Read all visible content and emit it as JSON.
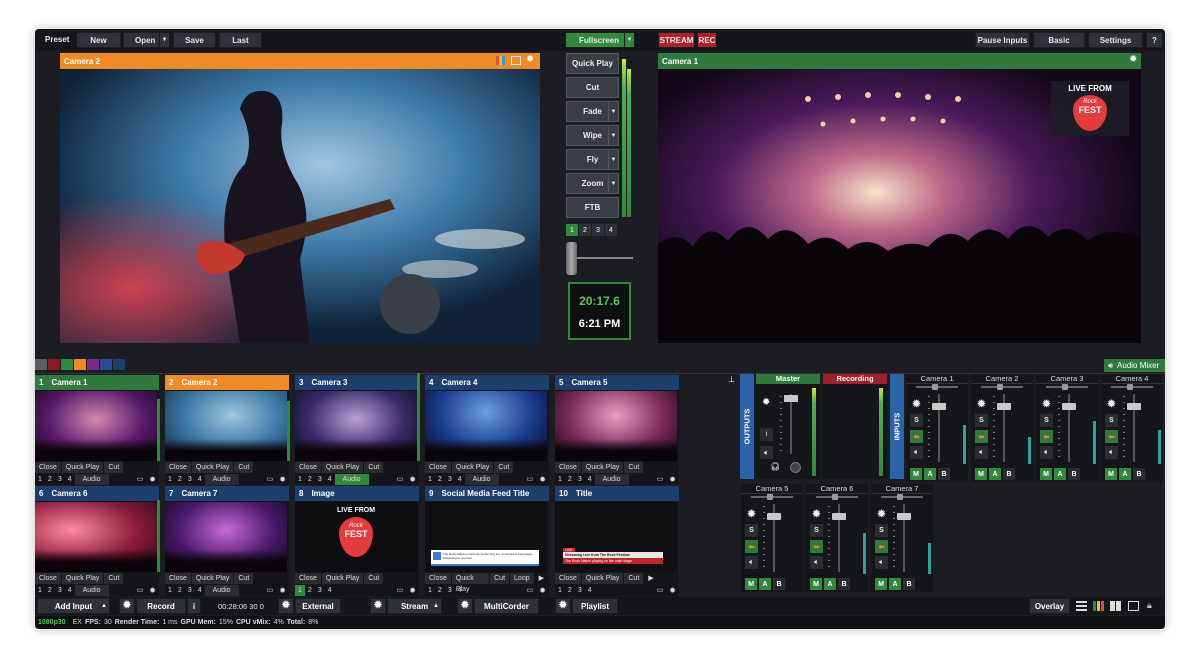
{
  "toolbar": {
    "preset": "Preset",
    "new": "New",
    "open": "Open",
    "save": "Save",
    "last": "Last",
    "fullscreen": "Fullscreen",
    "stream": "STREAM",
    "rec": "REC",
    "pause_inputs": "Pause Inputs",
    "basic": "Basic",
    "settings": "Settings",
    "help": "?"
  },
  "preview": {
    "title": "Camera 2"
  },
  "output": {
    "title": "Camera 1",
    "logo_top": "LIVE FROM",
    "logo_mid": "Rock",
    "logo_bot": "FEST"
  },
  "transitions": {
    "quick_play": "Quick Play",
    "cut": "Cut",
    "fade": "Fade",
    "wipe": "Wipe",
    "fly": "Fly",
    "zoom": "Zoom",
    "ftb": "FTB",
    "pages": [
      "1",
      "2",
      "3",
      "4"
    ],
    "t_bar_level": 0.0
  },
  "clock": {
    "elapsed": "20:17.6",
    "time": "6:21 PM"
  },
  "colors": {
    "accent_green": "#2f8a3c",
    "accent_orange": "#f08a24",
    "accent_red": "#b21e2a",
    "accent_blue": "#1e3f6e",
    "swatches": [
      "#5a5c62",
      "#8a1a2a",
      "#2f8a3c",
      "#f08a24",
      "#7a2a8a",
      "#2a4a9a",
      "#1e3f6e"
    ]
  },
  "audio_mixer": {
    "label": "Audio Mixer"
  },
  "inputs": [
    {
      "num": "1",
      "name": "Camera 1",
      "close": "Close",
      "quick_play": "Quick Play",
      "cut": "Cut",
      "pages": [
        "1",
        "2",
        "3",
        "4"
      ],
      "audio": "Audio",
      "audio_on": false
    },
    {
      "num": "2",
      "name": "Camera 2",
      "close": "Close",
      "quick_play": "Quick Play",
      "cut": "Cut",
      "pages": [
        "1",
        "2",
        "3",
        "4"
      ],
      "audio": "Audio",
      "audio_on": false
    },
    {
      "num": "3",
      "name": "Camera 3",
      "close": "Close",
      "quick_play": "Quick Play",
      "cut": "Cut",
      "pages": [
        "1",
        "2",
        "3",
        "4"
      ],
      "audio": "Audio",
      "audio_on": true
    },
    {
      "num": "4",
      "name": "Camera 4",
      "close": "Close",
      "quick_play": "Quick Play",
      "cut": "Cut",
      "pages": [
        "1",
        "2",
        "3",
        "4"
      ],
      "audio": "Audio",
      "audio_on": false
    },
    {
      "num": "5",
      "name": "Camera 5",
      "close": "Close",
      "quick_play": "Quick Play",
      "cut": "Cut",
      "pages": [
        "1",
        "2",
        "3",
        "4"
      ],
      "audio": "Audio",
      "audio_on": false
    },
    {
      "num": "6",
      "name": "Camera 6",
      "close": "Close",
      "quick_play": "Quick Play",
      "cut": "Cut",
      "pages": [
        "1",
        "2",
        "3",
        "4"
      ],
      "audio": "Audio",
      "audio_on": false
    },
    {
      "num": "7",
      "name": "Camera 7",
      "close": "Close",
      "quick_play": "Quick Play",
      "cut": "Cut",
      "pages": [
        "1",
        "2",
        "3",
        "4"
      ],
      "audio": "Audio",
      "audio_on": false
    },
    {
      "num": "8",
      "name": "Image",
      "close": "Close",
      "quick_play": "Quick Play",
      "cut": "Cut",
      "pages": [
        "1",
        "2",
        "3",
        "4"
      ],
      "logo_top": "LIVE FROM",
      "logo_mid": "Rock",
      "logo_bot": "FEST"
    },
    {
      "num": "9",
      "name": "Social Media Feed Title",
      "close": "Close",
      "quick_play": "Quick Play",
      "cut": "Cut",
      "loop": "Loop",
      "pages": [
        "1",
        "2",
        "3",
        "4"
      ],
      "feed_line": "The Rock Nation's currently performing live on the Rock Fest stage. Streaming to you live!"
    },
    {
      "num": "10",
      "name": "Title",
      "close": "Close",
      "quick_play": "Quick Play",
      "cut": "Cut",
      "pages": [
        "1",
        "2",
        "3",
        "4"
      ],
      "lt_tag": "LIVE",
      "lt_title": "Streaming Live from The Rock Festival",
      "lt_sub": "The Rock Nation playing on the main stage"
    }
  ],
  "mixer": {
    "outputs": "OUTPUTS",
    "inputs_label": "INPUTS",
    "master": "Master",
    "recording": "Recording",
    "info": "i",
    "m": "M",
    "a": "A",
    "b": "B",
    "s": "S",
    "strips_top": [
      {
        "name": "Camera 1",
        "level": 0.55
      },
      {
        "name": "Camera 2",
        "level": 0.38
      },
      {
        "name": "Camera 3",
        "level": 0.62
      },
      {
        "name": "Camera 4",
        "level": 0.48
      }
    ],
    "strips_bottom": [
      {
        "name": "Camera 5",
        "level": 0.0
      },
      {
        "name": "Camera 6",
        "level": 0.58
      },
      {
        "name": "Camera 7",
        "level": 0.44
      }
    ]
  },
  "bottom": {
    "add_input": "Add Input",
    "record": "Record",
    "info": "i",
    "rec_time": "00:28:06 30 0",
    "external": "External",
    "stream": "Stream",
    "multicorder": "MultiCorder",
    "playlist": "Playlist",
    "overlay": "Overlay"
  },
  "status": {
    "format": "1080p30",
    "ex": "EX",
    "fps_label": "FPS:",
    "fps": "30",
    "render_label": "Render Time:",
    "render": "1 ms",
    "gpu_label": "GPU Mem:",
    "gpu": "15%",
    "cpu_label": "CPU vMix:",
    "cpu": "4%",
    "total_label": "Total:",
    "total": "8%"
  }
}
